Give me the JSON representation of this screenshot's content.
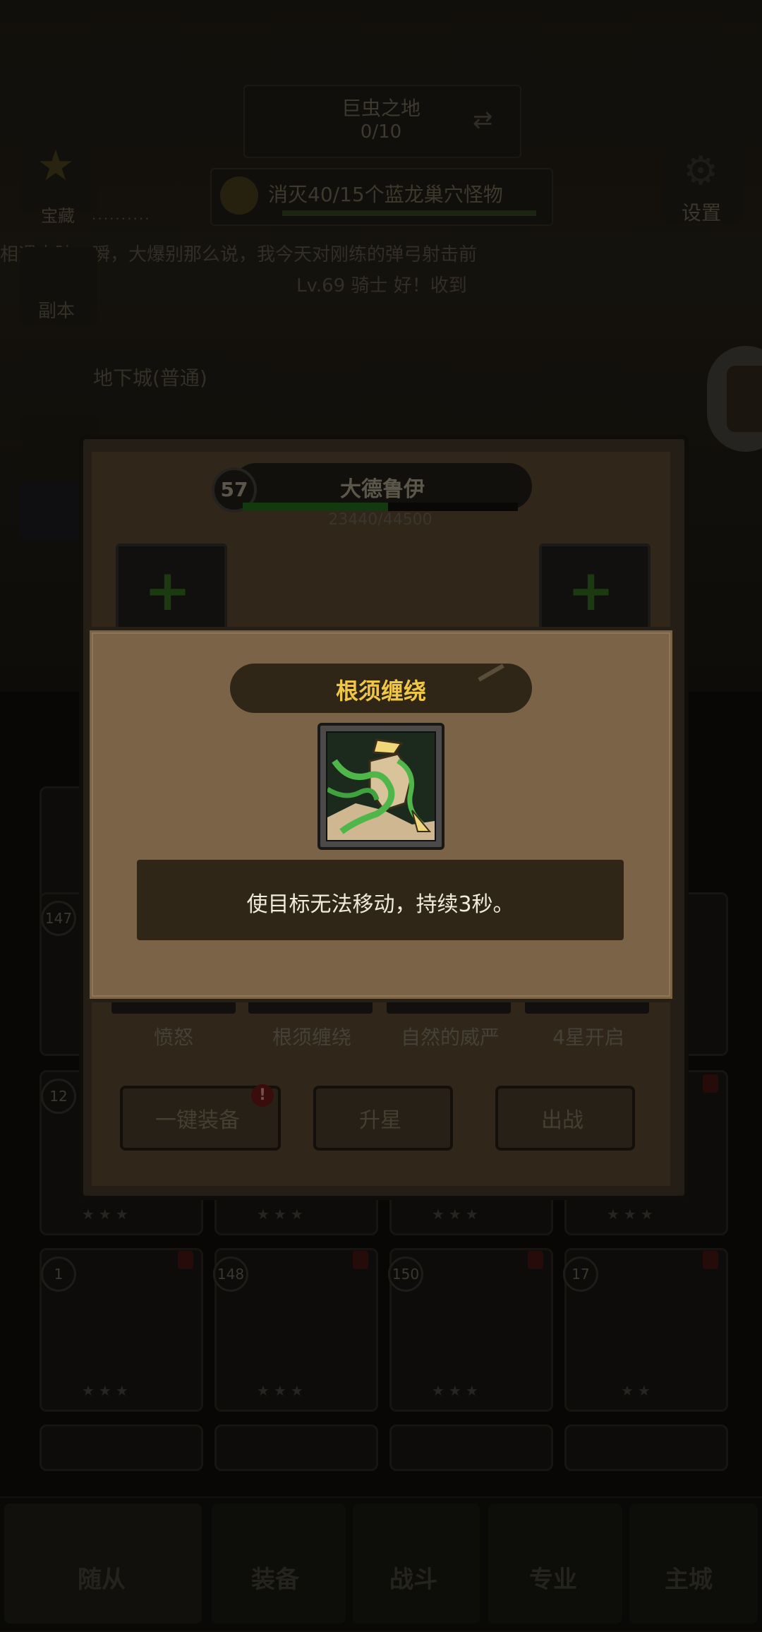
{
  "top": {
    "area_name": "巨虫之地",
    "area_progress": "0/10",
    "quest_text": "消灭40/15个蓝龙巢穴怪物",
    "star_label": "宝藏",
    "dots": "··········",
    "settings_label": "设置",
    "chat_line1": "相遇大陆一瞬，大爆别那么说，我今天对刚练的弹弓射击前",
    "chat_line2": "Lv.69 骑士 好！收到",
    "dungeon_label": "副本",
    "dungeon_button": "地下城(普通)"
  },
  "hero": {
    "level": "57",
    "name": "大德鲁伊",
    "xp_text": "23440/44500",
    "xp_fraction": 0.527
  },
  "skills": [
    "愤怒",
    "根须缠绕",
    "自然的威严",
    "4星开启"
  ],
  "actions": {
    "equip_all": "一键装备",
    "star_up": "升星",
    "deploy": "出战",
    "alert": "!"
  },
  "grid": {
    "row2_levels": [
      "147",
      "",
      "",
      ""
    ],
    "row3_levels": [
      "12",
      "",
      "",
      ""
    ],
    "row4_levels": [
      "1",
      "148",
      "150",
      "17"
    ],
    "stars": "★★★",
    "stars_two": "★★"
  },
  "popup": {
    "title": "根须缠绕",
    "icon": "root-entangle-icon",
    "description": "使目标无法移动，持续3秒。"
  },
  "nav": {
    "followers": "随从",
    "equipment": "装备",
    "battle": "战斗",
    "profession": "专业",
    "main_city": "主城"
  },
  "colors": {
    "popup_bg": "#7a6347",
    "title_gold": "#f0c646",
    "desc_bg": "#2f2618",
    "xp_green": "#1e5a18"
  }
}
